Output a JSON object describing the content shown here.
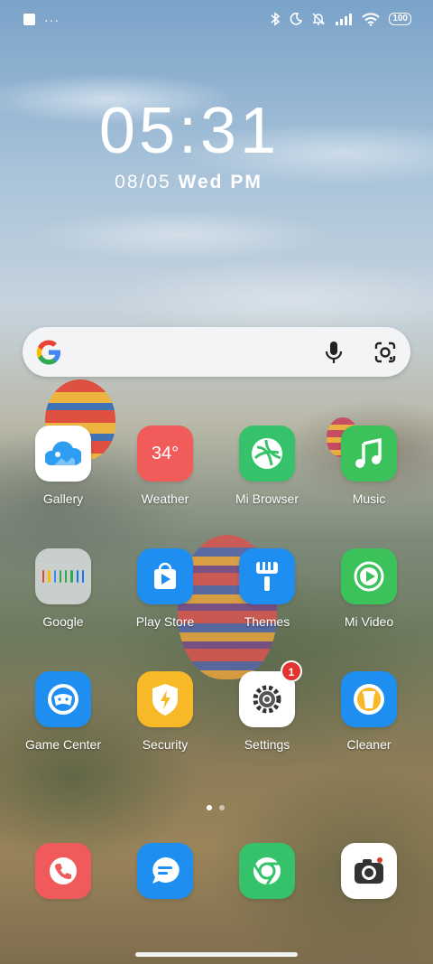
{
  "status_bar": {
    "notification_icons": [
      "app-square-icon",
      "more-dots-icon"
    ],
    "more_dots": "···",
    "system_icons": [
      "bluetooth-icon",
      "moon-icon",
      "bell-off-icon",
      "signal-icon",
      "wifi-icon"
    ],
    "battery": "100"
  },
  "clock": {
    "time": "05:31",
    "date": "08/05",
    "weekday": "Wed",
    "ampm": "PM"
  },
  "search_bar": {
    "icons": [
      "google-g-icon",
      "mic-icon",
      "google-lens-icon"
    ]
  },
  "apps": [
    {
      "label": "Gallery",
      "color": "#ffffff"
    },
    {
      "label": "Weather",
      "color": "#f15b5a",
      "icon_text": "34°"
    },
    {
      "label": "Mi Browser",
      "color": "#35c26a"
    },
    {
      "label": "Music",
      "color": "#3cc25a"
    },
    {
      "label": "Google",
      "color": "rgba(230,232,236,.75)"
    },
    {
      "label": "Play Store",
      "color": "#1e8ff0"
    },
    {
      "label": "Themes",
      "color": "#1e8ff0"
    },
    {
      "label": "Mi Video",
      "color": "#3cc25a"
    },
    {
      "label": "Game Center",
      "color": "#1e8ff0"
    },
    {
      "label": "Security",
      "color": "#f7b928"
    },
    {
      "label": "Settings",
      "color": "#ffffff",
      "badge": "1"
    },
    {
      "label": "Cleaner",
      "color": "#1e8ff0"
    }
  ],
  "dock": [
    {
      "name": "Phone",
      "color": "#f05a5a"
    },
    {
      "name": "Messages",
      "color": "#1e8ff0"
    },
    {
      "name": "Chrome",
      "color": "#35c26a"
    },
    {
      "name": "Camera",
      "color": "#ffffff"
    }
  ],
  "page_indicator": {
    "pages": 2,
    "current": 1
  }
}
